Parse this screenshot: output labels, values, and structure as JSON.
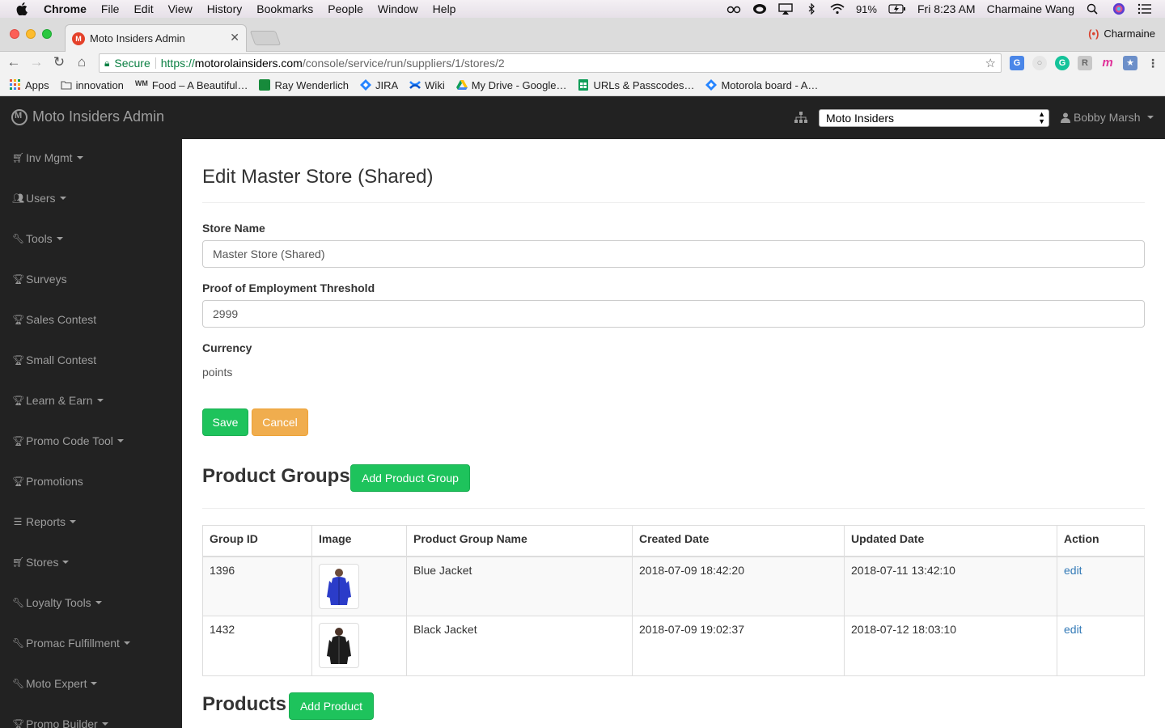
{
  "mac_menu": {
    "app": "Chrome",
    "items": [
      "File",
      "Edit",
      "View",
      "History",
      "Bookmarks",
      "People",
      "Window",
      "Help"
    ],
    "battery": "91%",
    "clock": "Fri 8:23 AM",
    "user": "Charmaine Wang"
  },
  "browser": {
    "tab_title": "Moto Insiders Admin",
    "profile_name": "Charmaine",
    "secure_label": "Secure",
    "url_scheme": "https://",
    "url_host": "motorolainsiders.com",
    "url_path": "/console/service/run/suppliers/1/stores/2",
    "bookmarks": [
      "Apps",
      "innovation",
      "Food – A Beautiful…",
      "Ray Wenderlich",
      "JIRA",
      "Wiki",
      "My Drive - Google…",
      "URLs & Passcodes…",
      "Motorola board - A…"
    ]
  },
  "navbar": {
    "brand": "Moto Insiders Admin",
    "store_select_value": "Moto Insiders",
    "user": "Bobby Marsh"
  },
  "sidebar": {
    "items": [
      {
        "label": "Inv Mgmt",
        "icon": "cart-icon",
        "dropdown": true
      },
      {
        "label": "Users",
        "icon": "users-icon",
        "dropdown": true
      },
      {
        "label": "Tools",
        "icon": "wrench-icon",
        "dropdown": true
      },
      {
        "label": "Surveys",
        "icon": "trophy-icon",
        "dropdown": false
      },
      {
        "label": "Sales Contest",
        "icon": "trophy-icon",
        "dropdown": false
      },
      {
        "label": "Small Contest",
        "icon": "trophy-icon",
        "dropdown": false
      },
      {
        "label": "Learn & Earn",
        "icon": "trophy-icon",
        "dropdown": true
      },
      {
        "label": "Promo Code Tool",
        "icon": "trophy-icon",
        "dropdown": true
      },
      {
        "label": "Promotions",
        "icon": "trophy-icon",
        "dropdown": false
      },
      {
        "label": "Reports",
        "icon": "list-icon",
        "dropdown": true
      },
      {
        "label": "Stores",
        "icon": "cart-icon",
        "dropdown": true
      },
      {
        "label": "Loyalty Tools",
        "icon": "wrench-icon",
        "dropdown": true
      },
      {
        "label": "Promac Fulfillment",
        "icon": "wrench-icon",
        "dropdown": true
      },
      {
        "label": "Moto Expert",
        "icon": "wrench-icon",
        "dropdown": true
      },
      {
        "label": "Promo Builder",
        "icon": "trophy-icon",
        "dropdown": true
      }
    ]
  },
  "form": {
    "title": "Edit Master Store (Shared)",
    "store_name_label": "Store Name",
    "store_name_value": "Master Store (Shared)",
    "threshold_label": "Proof of Employment Threshold",
    "threshold_value": "2999",
    "currency_label": "Currency",
    "currency_value": "points",
    "save_label": "Save",
    "cancel_label": "Cancel"
  },
  "product_groups": {
    "title": "Product Groups",
    "add_label": "Add Product Group",
    "columns": [
      "Group ID",
      "Image",
      "Product Group Name",
      "Created Date",
      "Updated Date",
      "Action"
    ],
    "rows": [
      {
        "id": "1396",
        "image": "blue-jacket-image",
        "name": "Blue Jacket",
        "created": "2018-07-09 18:42:20",
        "updated": "2018-07-11 13:42:10",
        "action": "edit"
      },
      {
        "id": "1432",
        "image": "black-jacket-image",
        "name": "Black Jacket",
        "created": "2018-07-09 19:02:37",
        "updated": "2018-07-12 18:03:10",
        "action": "edit"
      }
    ]
  },
  "products": {
    "title": "Products",
    "add_label": "Add Product"
  },
  "colors": {
    "nav_bg": "#222222",
    "nav_text": "#9d9d9d",
    "btn_green": "#1ec35c",
    "btn_orange": "#f0ad4e",
    "link": "#337ab7"
  }
}
